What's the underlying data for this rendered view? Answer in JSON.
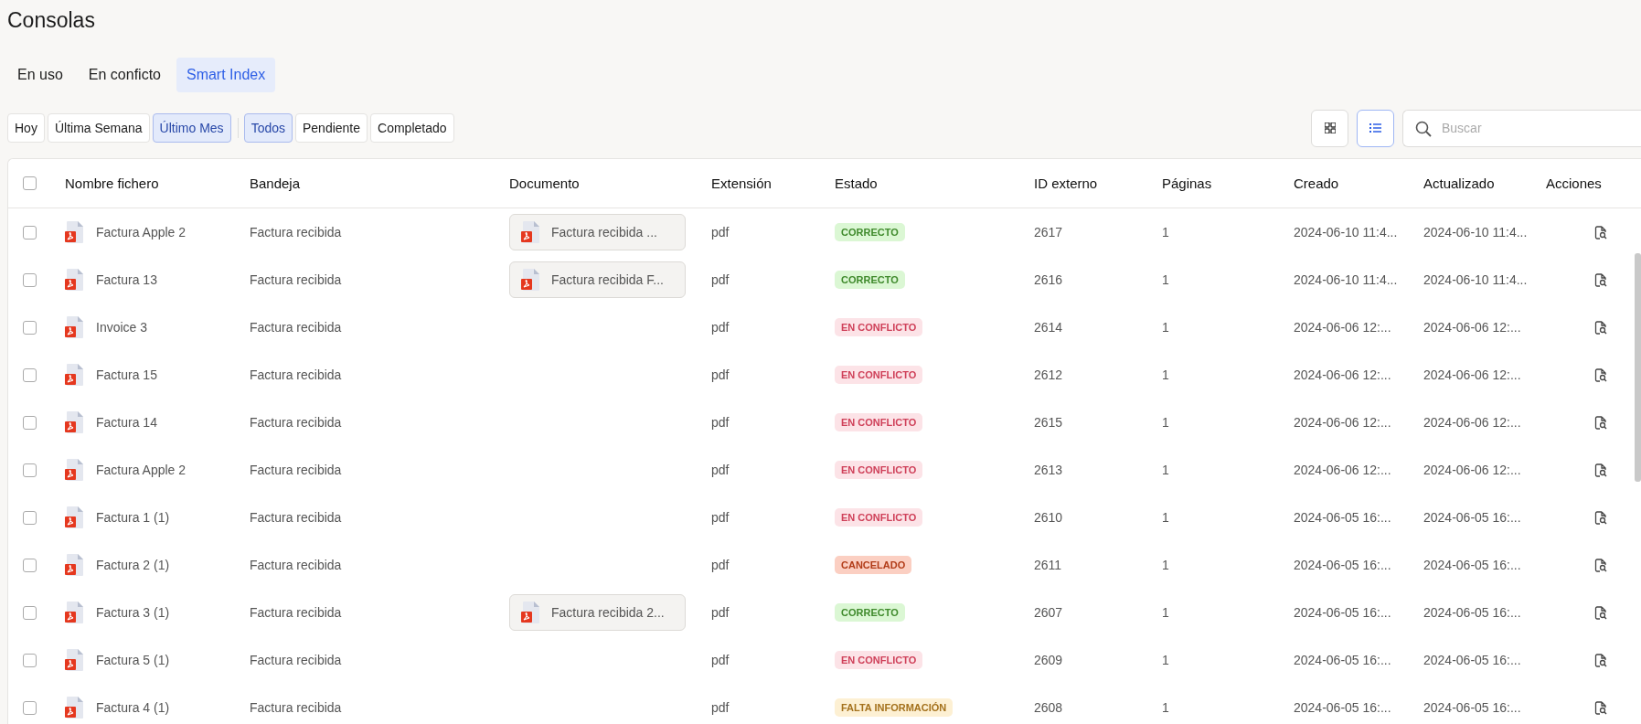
{
  "page": {
    "title": "Consolas"
  },
  "tabs": [
    {
      "label": "En uso",
      "selected": false
    },
    {
      "label": "En conficto",
      "selected": false
    },
    {
      "label": "Smart Index",
      "selected": true
    }
  ],
  "date_filters": [
    {
      "label": "Hoy",
      "selected": false
    },
    {
      "label": "Última Semana",
      "selected": false
    },
    {
      "label": "Último Mes",
      "selected": true
    }
  ],
  "status_filters": [
    {
      "label": "Todos",
      "selected": true
    },
    {
      "label": "Pendiente",
      "selected": false
    },
    {
      "label": "Completado",
      "selected": false
    }
  ],
  "view_toggle": [
    {
      "kind": "grid",
      "selected": false
    },
    {
      "kind": "list",
      "selected": true
    }
  ],
  "search": {
    "placeholder": "Buscar"
  },
  "table": {
    "select_all": {
      "checked": false
    },
    "columns": [
      "Nombre fichero",
      "Bandeja",
      "Documento",
      "Extensión",
      "Estado",
      "ID externo",
      "Páginas",
      "Creado",
      "Actualizado",
      "Acciones"
    ],
    "rows": [
      {
        "checked": false,
        "name": "Factura Apple 2",
        "tray": "Factura recibida",
        "document": "Factura recibida ...",
        "extension": "pdf",
        "status": {
          "label": "CORRECTO",
          "kind": "ok"
        },
        "external_id": "2617",
        "pages": "1",
        "created": "2024-06-10 11:4...",
        "updated": "2024-06-10 11:4..."
      },
      {
        "checked": false,
        "name": "Factura 13",
        "tray": "Factura recibida",
        "document": "Factura recibida F...",
        "extension": "pdf",
        "status": {
          "label": "CORRECTO",
          "kind": "ok"
        },
        "external_id": "2616",
        "pages": "1",
        "created": "2024-06-10 11:4...",
        "updated": "2024-06-10 11:4..."
      },
      {
        "checked": false,
        "name": "Invoice 3",
        "tray": "Factura recibida",
        "extension": "pdf",
        "status": {
          "label": "EN CONFLICTO",
          "kind": "conflict"
        },
        "external_id": "2614",
        "pages": "1",
        "created": "2024-06-06 12:...",
        "updated": "2024-06-06 12:..."
      },
      {
        "checked": false,
        "name": "Factura 15",
        "tray": "Factura recibida",
        "extension": "pdf",
        "status": {
          "label": "EN CONFLICTO",
          "kind": "conflict"
        },
        "external_id": "2612",
        "pages": "1",
        "created": "2024-06-06 12:...",
        "updated": "2024-06-06 12:..."
      },
      {
        "checked": false,
        "name": "Factura 14",
        "tray": "Factura recibida",
        "extension": "pdf",
        "status": {
          "label": "EN CONFLICTO",
          "kind": "conflict"
        },
        "external_id": "2615",
        "pages": "1",
        "created": "2024-06-06 12:...",
        "updated": "2024-06-06 12:..."
      },
      {
        "checked": false,
        "name": "Factura Apple 2",
        "tray": "Factura recibida",
        "extension": "pdf",
        "status": {
          "label": "EN CONFLICTO",
          "kind": "conflict"
        },
        "external_id": "2613",
        "pages": "1",
        "created": "2024-06-06 12:...",
        "updated": "2024-06-06 12:..."
      },
      {
        "checked": false,
        "name": "Factura 1 (1)",
        "tray": "Factura recibida",
        "extension": "pdf",
        "status": {
          "label": "EN CONFLICTO",
          "kind": "conflict"
        },
        "external_id": "2610",
        "pages": "1",
        "created": "2024-06-05 16:...",
        "updated": "2024-06-05 16:..."
      },
      {
        "checked": false,
        "name": "Factura 2 (1)",
        "tray": "Factura recibida",
        "extension": "pdf",
        "status": {
          "label": "CANCELADO",
          "kind": "cancelled"
        },
        "external_id": "2611",
        "pages": "1",
        "created": "2024-06-05 16:...",
        "updated": "2024-06-05 16:..."
      },
      {
        "checked": false,
        "name": "Factura 3 (1)",
        "tray": "Factura recibida",
        "document": "Factura recibida 2...",
        "extension": "pdf",
        "status": {
          "label": "CORRECTO",
          "kind": "ok"
        },
        "external_id": "2607",
        "pages": "1",
        "created": "2024-06-05 16:...",
        "updated": "2024-06-05 16:..."
      },
      {
        "checked": false,
        "name": "Factura 5 (1)",
        "tray": "Factura recibida",
        "extension": "pdf",
        "status": {
          "label": "EN CONFLICTO",
          "kind": "conflict"
        },
        "external_id": "2609",
        "pages": "1",
        "created": "2024-06-05 16:...",
        "updated": "2024-06-05 16:..."
      },
      {
        "checked": false,
        "name": "Factura 4 (1)",
        "tray": "Factura recibida",
        "extension": "pdf",
        "status": {
          "label": "FALTA INFORMACIÓN",
          "kind": "missing"
        },
        "external_id": "2608",
        "pages": "1",
        "created": "2024-06-05 16:...",
        "updated": "2024-06-05 16:..."
      }
    ]
  }
}
